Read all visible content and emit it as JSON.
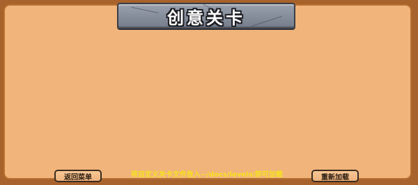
{
  "title": "创意关卡",
  "buttons": {
    "back_label": "返回菜单",
    "reload_label": "重新加载"
  },
  "hint_text": "将自定义关卡文件放入~/docs/levels/即可加载",
  "colors": {
    "background_border": "#a8622c",
    "panel": "#f1b47b",
    "plaque": "#858c9a",
    "hint": "#f7e11f"
  }
}
